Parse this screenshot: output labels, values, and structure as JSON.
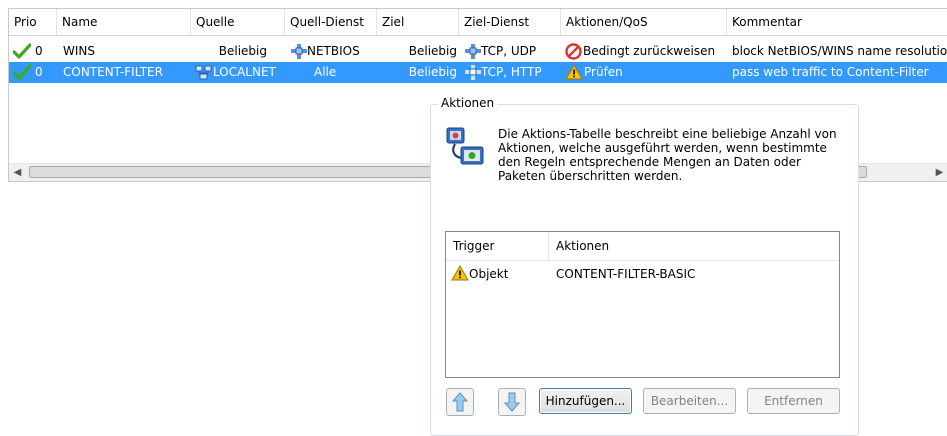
{
  "table": {
    "columns": [
      "Prio",
      "Name",
      "Quelle",
      "Quell-Dienst",
      "Ziel",
      "Ziel-Dienst",
      "Aktionen/QoS",
      "Kommentar"
    ],
    "rows": [
      {
        "prio": "0",
        "name": "WINS",
        "quelle": "Beliebig",
        "quell_dienst": "NETBIOS",
        "ziel": "Beliebig",
        "ziel_dienst": "TCP, UDP",
        "aktion": "Bedingt zurückweisen",
        "kommentar": "block NetBIOS/WINS name resolution"
      },
      {
        "prio": "0",
        "name": "CONTENT-FILTER",
        "quelle": "LOCALNET",
        "quell_dienst": "Alle",
        "ziel": "Beliebig",
        "ziel_dienst": "TCP, HTTP",
        "aktion": "Prüfen",
        "kommentar": "pass web traffic to Content-Filter"
      }
    ]
  },
  "actions_panel": {
    "title": "Aktionen",
    "description": "Die Aktions-Tabelle beschreibt eine beliebige Anzahl von Aktionen, welche ausgeführt werden, wenn bestimmte den Regeln entsprechende Mengen an Daten oder Paketen überschritten werden.",
    "columns": [
      "Trigger",
      "Aktionen"
    ],
    "rows": [
      {
        "trigger": "Objekt",
        "aktion": "CONTENT-FILTER-BASIC"
      }
    ],
    "buttons": {
      "add": "Hinzufügen...",
      "edit": "Bearbeiten...",
      "remove": "Entfernen"
    }
  },
  "colors": {
    "selection": "#3399ff",
    "check": "#3aaa1c",
    "deny": "#e0302a",
    "warn": "#f5c400"
  }
}
